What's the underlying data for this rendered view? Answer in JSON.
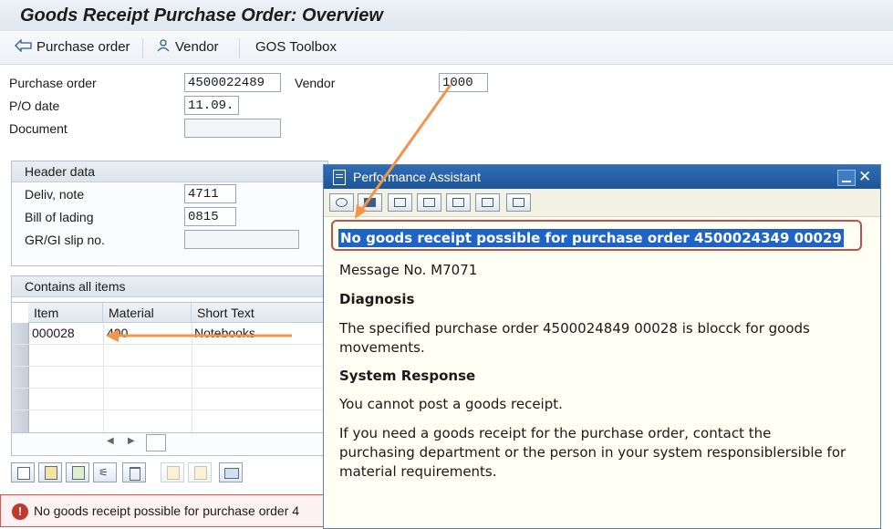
{
  "window": {
    "title": "Goods Receipt Purchase Order: Overview"
  },
  "toolbar": {
    "purchase_order_label": "Purchase order",
    "vendor_label": "Vendor",
    "gos_toolbox_label": "GOS Toolbox"
  },
  "header_fields": {
    "purchase_order": {
      "label": "Purchase order",
      "value": "4500022489"
    },
    "vendor": {
      "label": "Vendor",
      "value": "1000"
    },
    "po_date": {
      "label": "P/O date",
      "value": "11.09."
    },
    "document": {
      "label": "Document",
      "value": ""
    }
  },
  "header_data": {
    "title": "Header data",
    "deliv_note": {
      "label": "Deliv, note",
      "value": "4711"
    },
    "bill_of_lading": {
      "label": "Bill of lading",
      "value": "0815"
    },
    "gr_gi_slip": {
      "label": "GR/GI slip no.",
      "value": ""
    }
  },
  "items": {
    "title": "Contains all items",
    "columns": [
      "Item",
      "Material",
      "Short Text"
    ],
    "rows": [
      {
        "item": "000028",
        "material": "400",
        "short_text": "Notebooks"
      }
    ]
  },
  "status_bar": {
    "type": "error",
    "message": "No goods receipt possible for purchase order 4"
  },
  "performance_assistant": {
    "title": "Performance Assistant",
    "headline": "No goods receipt possible for purchase order 4500024349 00029",
    "message_no": "Message No. M7071",
    "diagnosis_heading": "Diagnosis",
    "diagnosis_text": "The specified purchase order 4500024849 00028 is blocck for goods movements.",
    "system_response_heading": "System Response",
    "system_response_text": "You cannot post a goods receipt.",
    "advice_text": "If you need a goods receipt for the purchase order, contact the purchasing department or the person in your system responsiblersible for material requirements."
  },
  "colors": {
    "highlight": "#1e64c8",
    "annotation_arrow": "#f0954a",
    "error": "#c0392b",
    "dialog_title": "#1f5599"
  }
}
